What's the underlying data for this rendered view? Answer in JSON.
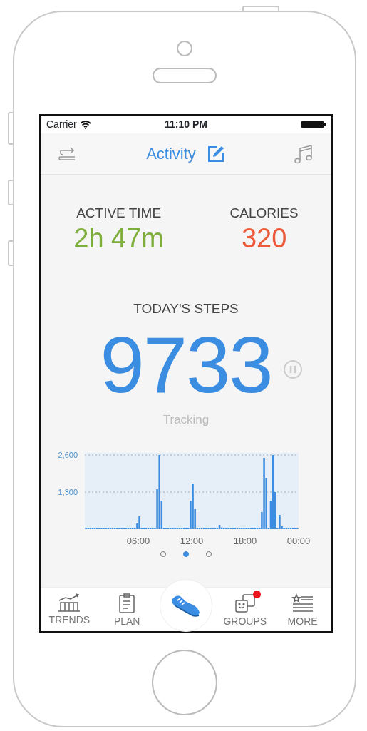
{
  "status_bar": {
    "carrier": "Carrier",
    "time": "11:10 PM"
  },
  "nav": {
    "title": "Activity"
  },
  "stats": [
    {
      "label": "ACTIVE TIME",
      "value": "2h 47m",
      "color": "#7fae3c"
    },
    {
      "label": "CALORIES",
      "value": "320",
      "color": "#ec5a3a"
    }
  ],
  "steps": {
    "label": "TODAY'S STEPS",
    "value": "9733",
    "status": "Tracking"
  },
  "chart_data": {
    "type": "bar",
    "values": [
      0,
      0,
      0,
      0,
      0,
      0,
      0,
      0,
      0,
      0,
      0,
      0,
      0,
      0,
      0,
      0,
      0,
      0,
      0,
      0,
      0,
      0,
      0,
      200,
      450,
      0,
      0,
      0,
      0,
      0,
      0,
      0,
      1400,
      2600,
      1000,
      0,
      0,
      0,
      0,
      0,
      0,
      0,
      0,
      0,
      0,
      0,
      0,
      1000,
      1600,
      700,
      0,
      0,
      0,
      0,
      0,
      0,
      0,
      0,
      0,
      0,
      150,
      60,
      0,
      0,
      0,
      0,
      0,
      0,
      0,
      0,
      0,
      0,
      0,
      0,
      0,
      0,
      0,
      0,
      0,
      600,
      2500,
      1800,
      0,
      1000,
      2600,
      1300,
      0,
      500,
      100,
      0,
      0,
      0,
      0,
      0,
      0,
      0
    ],
    "x": [
      0,
      0.25,
      0.5,
      0.75,
      1,
      1.25,
      1.5,
      1.75,
      2,
      2.25,
      2.5,
      2.75,
      3,
      3.25,
      3.5,
      3.75,
      4,
      4.25,
      4.5,
      4.75,
      5,
      5.25,
      5.5,
      5.75,
      6,
      6.25,
      6.5,
      6.75,
      7,
      7.25,
      7.5,
      7.75,
      8,
      8.25,
      8.5,
      8.75,
      9,
      9.25,
      9.5,
      9.75,
      10,
      10.25,
      10.5,
      10.75,
      11,
      11.25,
      11.5,
      11.75,
      12,
      12.25,
      12.5,
      12.75,
      13,
      13.25,
      13.5,
      13.75,
      14,
      14.25,
      14.5,
      14.75,
      15,
      15.25,
      15.5,
      15.75,
      16,
      16.25,
      16.5,
      16.75,
      17,
      17.25,
      17.5,
      17.75,
      18,
      18.25,
      18.5,
      18.75,
      19,
      19.25,
      19.5,
      19.75,
      20,
      20.25,
      20.5,
      20.75,
      21,
      21.25,
      21.5,
      21.75,
      22,
      22.25,
      22.5,
      22.75,
      23,
      23.25,
      23.5,
      23.75
    ],
    "color": "#3a8de0",
    "xlim": [
      0,
      24
    ],
    "ylim": [
      0,
      2600
    ],
    "yticks": [
      {
        "value": 1300,
        "label": "1,300"
      },
      {
        "value": 2600,
        "label": "2,600"
      }
    ],
    "xticks": [
      {
        "value": 6,
        "label": "06:00"
      },
      {
        "value": 12,
        "label": "12:00"
      },
      {
        "value": 18,
        "label": "18:00"
      },
      {
        "value": 24,
        "label": "00:00"
      }
    ]
  },
  "page_dots": [
    {
      "selected": false
    },
    {
      "selected": true
    },
    {
      "selected": false
    }
  ],
  "tab_bar": [
    {
      "kind": "trends",
      "label": "TRENDS",
      "selected": false,
      "badge": false
    },
    {
      "kind": "plan",
      "label": "PLAN",
      "selected": false,
      "badge": false
    },
    {
      "kind": "shoe",
      "selected": true
    },
    {
      "kind": "groups",
      "label": "GROUPS",
      "selected": false,
      "badge": true
    },
    {
      "kind": "more",
      "label": "MORE",
      "selected": false,
      "badge": false
    }
  ]
}
